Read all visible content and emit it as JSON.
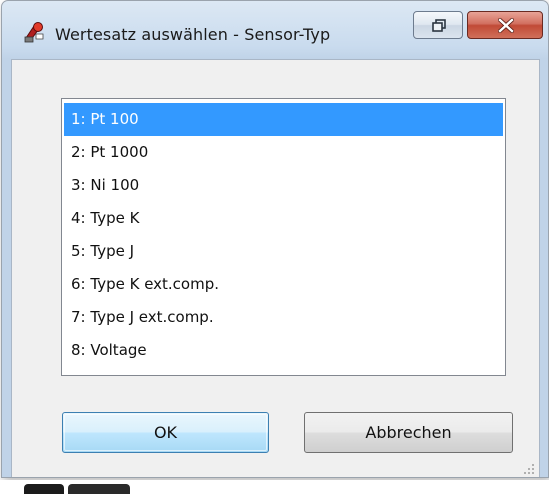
{
  "window": {
    "title": "Wertesatz auswählen - Sensor-Typ",
    "app_icon": "sensor-app-icon",
    "controls": {
      "restore_icon": "restore-icon",
      "close_icon": "close-icon"
    }
  },
  "list": {
    "selected_index": 0,
    "items": [
      "1: Pt 100",
      "2: Pt 1000",
      "3: Ni 100",
      "4: Type K",
      "5: Type J",
      "6: Type K ext.comp.",
      "7: Type J ext.comp.",
      "8: Voltage"
    ]
  },
  "buttons": {
    "ok_label": "OK",
    "cancel_label": "Abbrechen"
  },
  "colors": {
    "selection": "#3399ff",
    "close_button": "#c14a36",
    "dialog_face": "#f0f0f0"
  }
}
